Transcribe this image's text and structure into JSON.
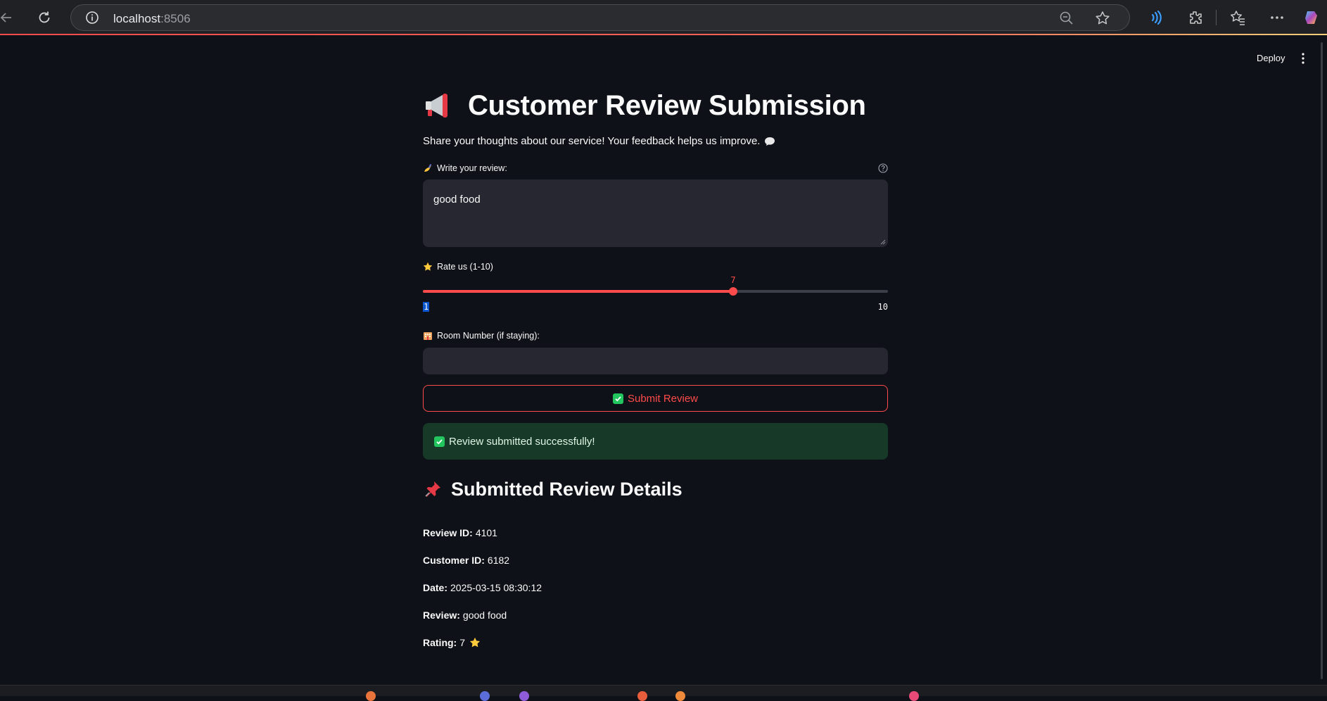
{
  "browser": {
    "url_host": "localhost",
    "url_port": ":8506"
  },
  "header": {
    "deploy_label": "Deploy"
  },
  "page": {
    "title": "Customer Review Submission",
    "title_icon": "megaphone-icon",
    "subtitle": "Share your thoughts about our service! Your feedback helps us improve.",
    "subtitle_icon": "speech-bubble-icon"
  },
  "form": {
    "review_label": "Write your review:",
    "review_value": "good food",
    "rating_label": "Rate us (1-10)",
    "rating_value": "7",
    "rating_min": "1",
    "rating_max": "10",
    "rating_fraction": 0.6667,
    "room_label": "Room Number (if staying):",
    "room_value": "",
    "submit_label": "Submit Review"
  },
  "alert": {
    "message": "Review submitted successfully!"
  },
  "details": {
    "title": "Submitted Review Details",
    "title_icon": "pushpin-icon",
    "items": [
      {
        "label": "Review ID:",
        "value": "4101"
      },
      {
        "label": "Customer ID:",
        "value": "6182"
      },
      {
        "label": "Date:",
        "value": "2025-03-15 08:30:12"
      },
      {
        "label": "Review:",
        "value": "good food"
      },
      {
        "label": "Rating:",
        "value": "7"
      }
    ]
  },
  "colors": {
    "background": "#0e1117",
    "accent": "#ff4b4b",
    "input_bg": "#262730",
    "success_bg": "#173928",
    "success_check": "#22c55e"
  }
}
